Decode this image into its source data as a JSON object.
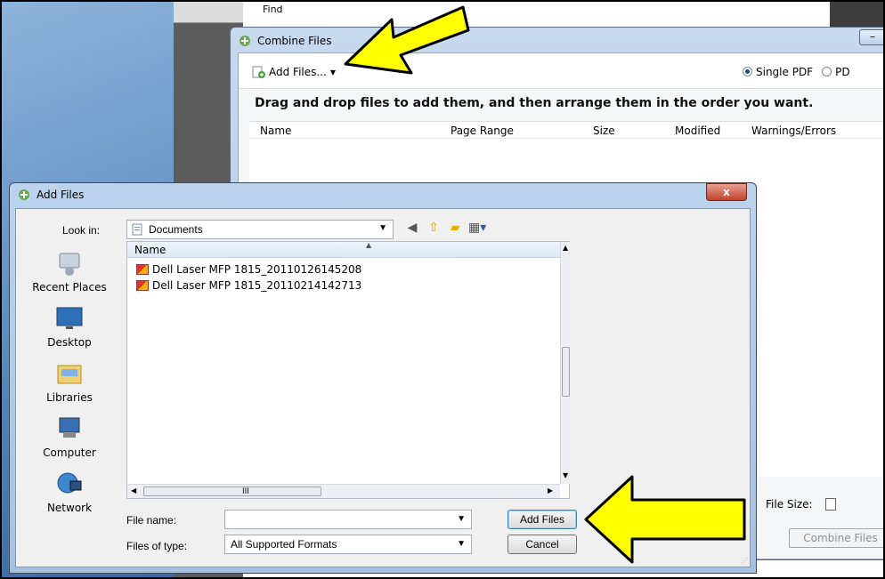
{
  "background_window": {
    "find_label": "Find"
  },
  "combine_files": {
    "title": "Combine Files",
    "add_files_label": "Add Files...",
    "mode_options": [
      "Single PDF",
      "PD"
    ],
    "selected_mode": "Single PDF",
    "instruction": "Drag and drop files to add them, and then arrange them in the order you want.",
    "columns": [
      "Name",
      "Page Range",
      "Size",
      "Modified",
      "Warnings/Errors"
    ],
    "file_size_label": "File Size:",
    "combine_button": "Combine Files",
    "minimize_symbol": "–"
  },
  "add_files_dialog": {
    "title": "Add Files",
    "close_symbol": "x",
    "look_in_label": "Look in:",
    "look_in_value": "Documents",
    "places": [
      "Recent Places",
      "Desktop",
      "Libraries",
      "Computer",
      "Network"
    ],
    "list_header": "Name",
    "files": [
      "Dell Laser MFP 1815_20110126145208",
      "Dell Laser MFP 1815_20110214142713"
    ],
    "file_name_label": "File name:",
    "file_name_value": "",
    "files_of_type_label": "Files of type:",
    "files_of_type_value": "All Supported Formats",
    "add_button": "Add Files",
    "cancel_button": "Cancel",
    "scroll_grip": "III"
  },
  "colors": {
    "highlight_arrow": "#ffff00",
    "title_bar": "#bcd3ec",
    "close_button": "#c0422a"
  }
}
